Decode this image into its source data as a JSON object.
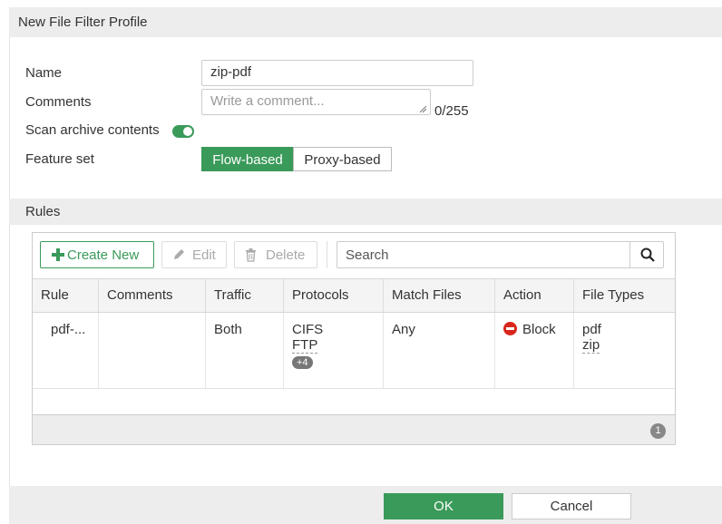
{
  "dialog": {
    "title": "New File Filter Profile"
  },
  "form": {
    "name_label": "Name",
    "name_value": "zip-pdf",
    "comments_label": "Comments",
    "comments_placeholder": "Write a comment...",
    "comments_counter": "0/255",
    "scan_archive_label": "Scan archive contents",
    "scan_archive_enabled": true,
    "feature_set_label": "Feature set",
    "feature_set_options": [
      "Flow-based",
      "Proxy-based"
    ],
    "feature_set_selected": "Flow-based"
  },
  "rules": {
    "section_title": "Rules",
    "toolbar": {
      "create_new_label": "Create New",
      "edit_label": "Edit",
      "delete_label": "Delete",
      "search_placeholder": "Search"
    },
    "columns": [
      "Rule",
      "Comments",
      "Traffic",
      "Protocols",
      "Match Files",
      "Action",
      "File Types"
    ],
    "rows": [
      {
        "rule": "pdf-...",
        "comments": "",
        "traffic": "Both",
        "protocols": [
          "CIFS",
          "FTP"
        ],
        "protocols_more": "+4",
        "match_files": "Any",
        "action": "Block",
        "file_types": [
          "pdf",
          "zip"
        ]
      }
    ],
    "total_count": "1"
  },
  "footer": {
    "ok_label": "OK",
    "cancel_label": "Cancel"
  },
  "colors": {
    "accent": "#3a9a5a",
    "block": "#d9261c",
    "header_bg": "#ededed"
  }
}
